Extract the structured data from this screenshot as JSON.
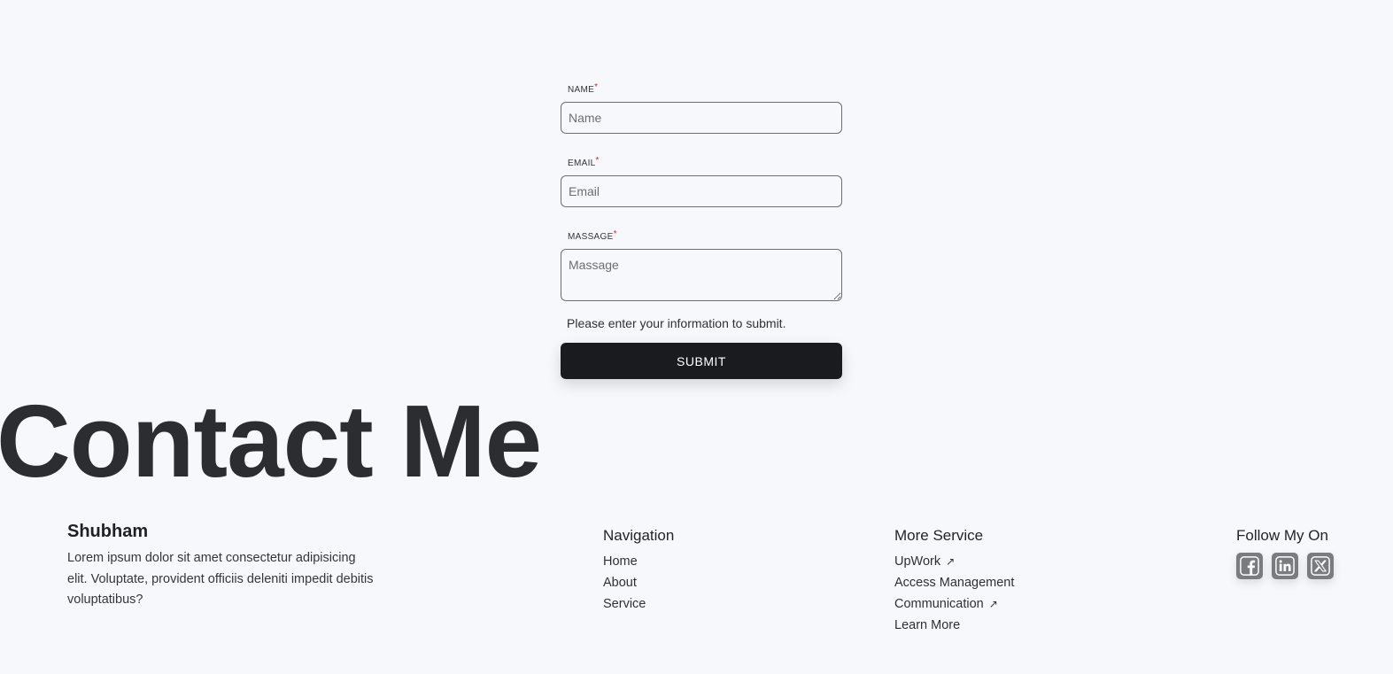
{
  "form": {
    "name_label": "NAME",
    "name_placeholder": "Name",
    "email_label": "EMAIL",
    "email_placeholder": "Email",
    "message_label": "MASSAGE",
    "message_placeholder": "Massage",
    "required_mark": "*",
    "hint": "Please enter your information to submit.",
    "submit_label": "SUBMIT"
  },
  "heading": "Contact Me",
  "footer": {
    "brand": {
      "name": "Shubham",
      "description": "Lorem ipsum dolor sit amet consectetur adipisicing elit. Voluptate, provident officiis deleniti impedit debitis voluptatibus?"
    },
    "navigation": {
      "title": "Navigation",
      "items": [
        "Home",
        "About",
        "Service"
      ]
    },
    "more_service": {
      "title": "More Service",
      "items": [
        {
          "label": "UpWork",
          "external": true
        },
        {
          "label": "Access Management",
          "external": false
        },
        {
          "label": "Communication",
          "external": true
        },
        {
          "label": "Learn More",
          "external": false
        }
      ],
      "external_arrow": "↗"
    },
    "follow": {
      "title": "Follow My On",
      "icons": [
        "facebook-icon",
        "linkedin-icon",
        "x-twitter-icon"
      ]
    }
  },
  "colors": {
    "background": "#f7f8fb",
    "button": "#1a1b1e",
    "required": "#d62c2c",
    "social": "#7a7b80"
  }
}
